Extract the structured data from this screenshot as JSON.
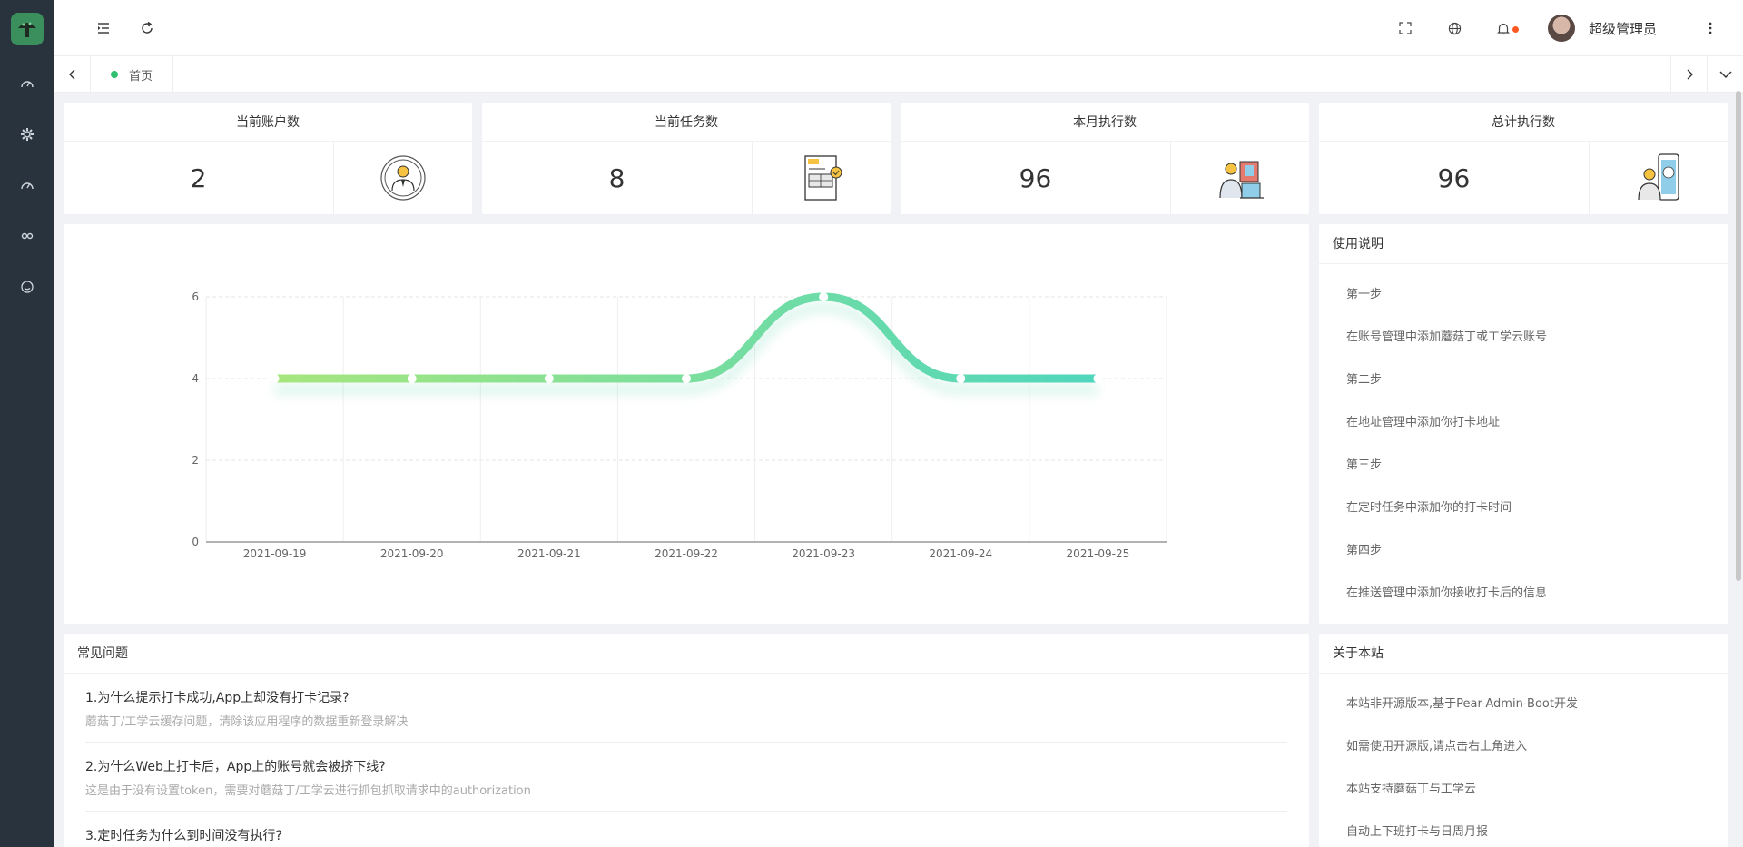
{
  "header": {
    "user_name": "超级管理员"
  },
  "tabs": {
    "home_label": "首页"
  },
  "stats": [
    {
      "title": "当前账户数",
      "value": "2",
      "icon": "user-avatar-icon"
    },
    {
      "title": "当前任务数",
      "value": "8",
      "icon": "invoice-icon"
    },
    {
      "title": "本月执行数",
      "value": "96",
      "icon": "worker-board-icon"
    },
    {
      "title": "总计执行数",
      "value": "96",
      "icon": "support-phone-icon"
    }
  ],
  "chart_data": {
    "type": "line",
    "x": [
      "2021-09-19",
      "2021-09-20",
      "2021-09-21",
      "2021-09-22",
      "2021-09-23",
      "2021-09-24",
      "2021-09-25"
    ],
    "series": [
      {
        "values": [
          4,
          4,
          4,
          4,
          6,
          4,
          4
        ]
      }
    ],
    "ylim": [
      0,
      6
    ],
    "yticks": [
      "0",
      "2",
      "4",
      "6"
    ],
    "grid": true,
    "smooth": true,
    "colors": [
      "#a6e67d",
      "#4fd6bd"
    ]
  },
  "usage": {
    "title": "使用说明",
    "items": [
      "第一步",
      "在账号管理中添加蘑菇丁或工学云账号",
      "第二步",
      "在地址管理中添加你打卡地址",
      "第三步",
      "在定时任务中添加你的打卡时间",
      "第四步",
      "在推送管理中添加你接收打卡后的信息"
    ]
  },
  "faq": {
    "title": "常见问题",
    "items": [
      {
        "q": "1.为什么提示打卡成功,App上却没有打卡记录?",
        "a": "蘑菇丁/工学云缓存问题，清除该应用程序的数据重新登录解决"
      },
      {
        "q": "2.为什么Web上打卡后，App上的账号就会被挤下线?",
        "a": "这是由于没有设置token，需要对蘑菇丁/工学云进行抓包抓取请求中的authorization"
      },
      {
        "q": "3.定时任务为什么到时间没有执行?",
        "a": ""
      }
    ]
  },
  "about": {
    "title": "关于本站",
    "items": [
      "本站非开源版本,基于Pear-Admin-Boot开发",
      "如需使用开源版,请点击右上角进入",
      "本站支持蘑菇丁与工学云",
      "自动上下班打卡与日周月报"
    ]
  }
}
